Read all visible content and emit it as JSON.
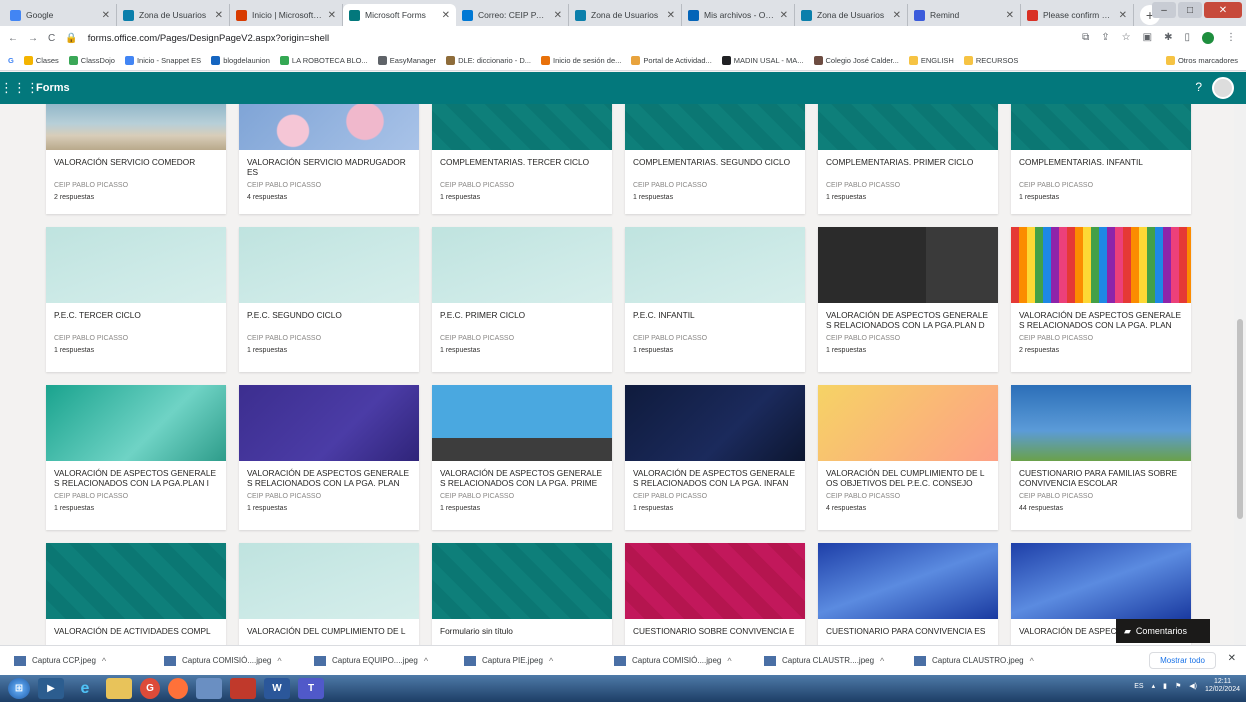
{
  "browser": {
    "tabs": [
      {
        "title": "Google",
        "color": "#4285f4"
      },
      {
        "title": "Zona de Usuarios",
        "color": "#0b7fab"
      },
      {
        "title": "Inicio | Microsoft 3(",
        "color": "#d83b01"
      },
      {
        "title": "Microsoft Forms",
        "color": "#03787c",
        "active": true
      },
      {
        "title": "Correo: CEIP PABLO",
        "color": "#0078d4"
      },
      {
        "title": "Zona de Usuarios",
        "color": "#0b7fab"
      },
      {
        "title": "Mis archivos - One[",
        "color": "#0364b8"
      },
      {
        "title": "Zona de Usuarios",
        "color": "#0b7fab"
      },
      {
        "title": "Remind",
        "color": "#3b5bdb"
      },
      {
        "title": "Please confirm you",
        "color": "#d93025"
      }
    ],
    "url": "forms.office.com/Pages/DesignPageV2.aspx?origin=shell",
    "bookmarks": [
      "Clases",
      "ClassDojo",
      "Inicio - Snappet ES",
      "blogdelaunion",
      "LA ROBOTECA BLO...",
      "EasyManager",
      "DLE: diccionario - D...",
      "Inicio de sesión de...",
      "Portal de Actividad...",
      "MADIN USAL - MA...",
      "Colegio José Calder...",
      "ENGLISH",
      "RECURSOS"
    ],
    "other_bookmarks": "Otros marcadores"
  },
  "app": {
    "name": "Forms",
    "help": "?"
  },
  "cards": [
    {
      "title": "VALORACIÓN SERVICIO COMEDOR",
      "org": "CEIP PABLO PICASSO",
      "resp": "2 respuestas",
      "thumb": "beach"
    },
    {
      "title": "VALORACIÓN SERVICIO MADRUGADOR ES",
      "org": "CEIP PABLO PICASSO",
      "resp": "4 respuestas",
      "thumb": "blossom"
    },
    {
      "title": "COMPLEMENTARIAS. TERCER CICLO",
      "org": "CEIP PABLO PICASSO",
      "resp": "1 respuestas",
      "thumb": "teal"
    },
    {
      "title": "COMPLEMENTARIAS. SEGUNDO CICLO",
      "org": "CEIP PABLO PICASSO",
      "resp": "1 respuestas",
      "thumb": "teal"
    },
    {
      "title": "COMPLEMENTARIAS. PRIMER CICLO",
      "org": "CEIP PABLO PICASSO",
      "resp": "1 respuestas",
      "thumb": "teal"
    },
    {
      "title": "COMPLEMENTARIAS. INFANTIL",
      "org": "CEIP PABLO PICASSO",
      "resp": "1 respuestas",
      "thumb": "teal"
    },
    {
      "title": "P.E.C. TERCER CICLO",
      "org": "CEIP PABLO PICASSO",
      "resp": "1 respuestas",
      "thumb": "desk"
    },
    {
      "title": "P.E.C. SEGUNDO CICLO",
      "org": "CEIP PABLO PICASSO",
      "resp": "1 respuestas",
      "thumb": "desk"
    },
    {
      "title": "P.E.C. PRIMER CICLO",
      "org": "CEIP PABLO PICASSO",
      "resp": "1 respuestas",
      "thumb": "desk"
    },
    {
      "title": "P.E.C. INFANTIL",
      "org": "CEIP PABLO PICASSO",
      "resp": "1 respuestas",
      "thumb": "desk"
    },
    {
      "title": "VALORACIÓN DE ASPECTOS GENERALE S RELACIONADOS CON LA PGA.PLAN D",
      "org": "CEIP PABLO PICASSO",
      "resp": "1 respuestas",
      "thumb": "pencils-dark"
    },
    {
      "title": "VALORACIÓN DE ASPECTOS GENERALE S RELACIONADOS CON LA PGA. PLAN",
      "org": "CEIP PABLO PICASSO",
      "resp": "2 respuestas",
      "thumb": "pencils"
    },
    {
      "title": "VALORACIÓN DE ASPECTOS GENERALE S RELACIONADOS CON LA PGA.PLAN I",
      "org": "CEIP PABLO PICASSO",
      "resp": "1 respuestas",
      "thumb": "green-wave"
    },
    {
      "title": "VALORACIÓN DE ASPECTOS GENERALE S RELACIONADOS CON LA PGA. PLAN",
      "org": "CEIP PABLO PICASSO",
      "resp": "1 respuestas",
      "thumb": "purple-office"
    },
    {
      "title": "VALORACIÓN DE ASPECTOS GENERALE S RELACIONADOS CON LA PGA. PRIME",
      "org": "CEIP PABLO PICASSO",
      "resp": "1 respuestas",
      "thumb": "city"
    },
    {
      "title": "VALORACIÓN DE ASPECTOS GENERALE S RELACIONADOS CON LA PGA. INFAN",
      "org": "CEIP PABLO PICASSO",
      "resp": "1 respuestas",
      "thumb": "space"
    },
    {
      "title": "VALORACIÓN DEL CUMPLIMIENTO DE L OS OBJETIVOS DEL P.E.C. CONSEJO ESC",
      "org": "CEIP PABLO PICASSO",
      "resp": "4 respuestas",
      "thumb": "books"
    },
    {
      "title": "CUESTIONARIO PARA FAMILIAS SOBRE CONVIVENCIA ESCOLAR",
      "org": "CEIP PABLO PICASSO",
      "resp": "44 respuestas",
      "thumb": "daisies"
    },
    {
      "title": "VALORACIÓN DE ACTIVIDADES COMPL",
      "org": "",
      "resp": "",
      "thumb": "teal"
    },
    {
      "title": "VALORACIÓN DEL CUMPLIMIENTO DE L",
      "org": "",
      "resp": "",
      "thumb": "desk"
    },
    {
      "title": "Formulario sin título",
      "org": "",
      "resp": "",
      "thumb": "teal"
    },
    {
      "title": "CUESTIONARIO SOBRE CONVIVENCIA E",
      "org": "",
      "resp": "",
      "thumb": "magenta"
    },
    {
      "title": "CUESTIONARIO PARA CONVIVENCIA ES",
      "org": "",
      "resp": "",
      "thumb": "blue-wave"
    },
    {
      "title": "VALORACIÓN DE ASPEC",
      "org": "",
      "resp": "",
      "thumb": "blue-wave"
    }
  ],
  "feedback_label": "Comentarios",
  "downloads": [
    "Captura CCP.jpeg",
    "Captura COMISIÓ....jpeg",
    "Captura EQUIPO....jpeg",
    "Captura PIE.jpeg",
    "Captura COMISIÓ....jpeg",
    "Captura CLAUSTR....jpeg",
    "Captura CLAUSTRO.jpeg"
  ],
  "show_all": "Mostrar todo",
  "tray": {
    "lang": "ES",
    "time": "12:11",
    "date": "12/02/2024"
  }
}
